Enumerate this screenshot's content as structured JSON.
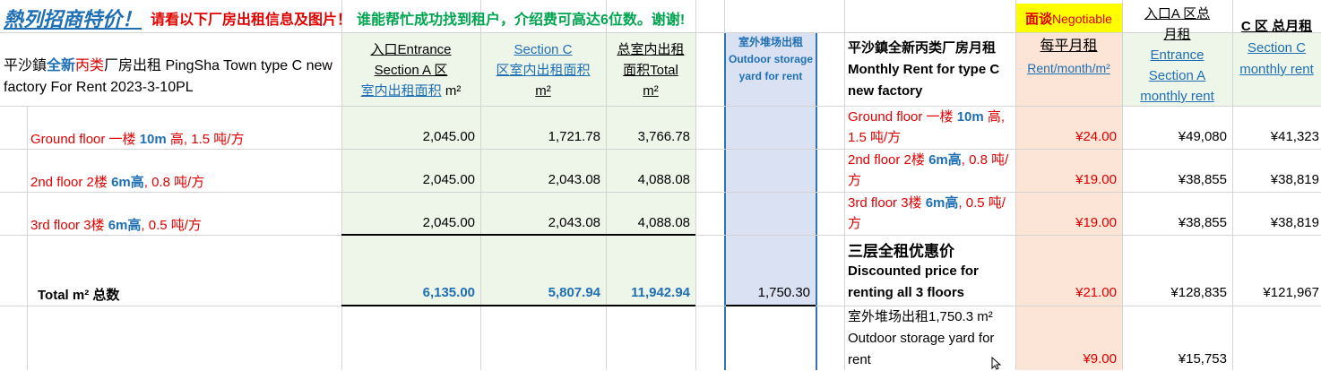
{
  "banner": {
    "title": "熱列招商特价！",
    "red_text": "请看以下厂房出租信息及图片！",
    "green_text": "谁能帮忙成功找到租户，介绍费可高达6位数。谢谢!"
  },
  "header": {
    "title_pre": "平沙鎮",
    "title_new": "全新",
    "title_c": "丙类",
    "title_rest": "厂房出租 PingSha Town type C new factory For Rent 2023-3-10PL",
    "col_a_line1": "入口Entrance",
    "col_a_line2": "Section A 区",
    "col_a_line3": "室内出租面积",
    "col_a_unit": "m²",
    "col_c_line1": "Section C",
    "col_c_line2": "区室内出租面积",
    "col_c_unit": "m²",
    "col_total_line1": "总室内出租",
    "col_total_line2": "面积Total",
    "col_total_unit": "m²",
    "col_outdoor": "室外堆场出租 Outdoor storage yard for rent",
    "rent_title": "平沙鎮全新丙类厂房月租 Monthly Rent for type C new factory",
    "negotiable_cn": "面谈",
    "negotiable_en": "Negotiable",
    "per_sqm_cn": "每平月租",
    "per_sqm_en": "Rent/month/m²",
    "a_monthly_cn": "入口A 区总月租",
    "a_monthly_en": "Entrance Section A monthly rent",
    "c_monthly_cn": "C 区 总月租",
    "c_monthly_en": "Section C monthly rent"
  },
  "rows": [
    {
      "floor_pre": "Ground floor 一楼 ",
      "floor_height": "10m",
      "floor_mid": " 高",
      "floor_load": ", 1.5 吨/方",
      "area_a": "2,045.00",
      "area_c": "1,721.78",
      "area_total": "3,766.78",
      "rent_desc_pre": "Ground floor 一楼 ",
      "rent_desc_height": "10m",
      "rent_desc_post": " 高, 1.5 吨/方",
      "price": "¥24.00",
      "rent_a": "¥49,080",
      "rent_c": "¥41,323"
    },
    {
      "floor_pre": "2nd floor 2楼 ",
      "floor_height": "6m高",
      "floor_mid": "",
      "floor_load": ", 0.8 吨/方",
      "area_a": "2,045.00",
      "area_c": "2,043.08",
      "area_total": "4,088.08",
      "rent_desc_pre": "2nd floor 2楼 ",
      "rent_desc_height": "6m高",
      "rent_desc_post": ", 0.8 吨/方",
      "price": "¥19.00",
      "rent_a": "¥38,855",
      "rent_c": "¥38,819"
    },
    {
      "floor_pre": "3rd floor 3楼 ",
      "floor_height": "6m高",
      "floor_mid": "",
      "floor_load": ", 0.5 吨/方",
      "area_a": "2,045.00",
      "area_c": "2,043.08",
      "area_total": "4,088.08",
      "rent_desc_pre": "3rd floor 3楼 ",
      "rent_desc_height": "6m高",
      "rent_desc_post": ", 0.5 吨/方",
      "price": "¥19.00",
      "rent_a": "¥38,855",
      "rent_c": "¥38,819"
    }
  ],
  "total": {
    "label": "Total m² 总数",
    "area_a": "6,135.00",
    "area_c": "5,807.94",
    "area_total": "11,942.94",
    "outdoor": "1,750.30",
    "discount_cn": "三层全租优惠价",
    "discount_en": "Discounted price for renting all 3 floors",
    "price": "¥21.00",
    "rent_a": "¥128,835",
    "rent_c": "¥121,967"
  },
  "outdoor_row": {
    "desc": "室外堆场出租1,750.3 m²  Outdoor storage yard for rent",
    "price": "¥9.00",
    "rent_a": "¥15,753"
  },
  "colors": {
    "red": "#e00000",
    "blue": "#1f6fb5",
    "green": "#00a550",
    "green_bg": "#eef5e9",
    "blue_bg": "#d9e1f2",
    "peach_bg": "#fce4d6",
    "yellow_bg": "#ffff00"
  }
}
